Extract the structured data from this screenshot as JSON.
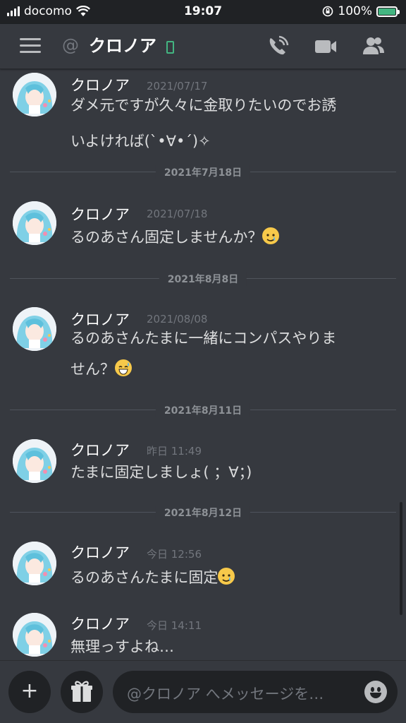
{
  "status_bar": {
    "carrier": "docomo",
    "time": "19:07",
    "battery": "100%",
    "battery_level": 1.0
  },
  "header": {
    "at_symbol": "@",
    "title": "クロノア"
  },
  "messages": [
    {
      "type": "message",
      "username": "クロノア",
      "timestamp": "2021/07/17",
      "lines": [
        "ダメ元ですが久々に金取りたいのでお誘",
        "いよければ(`•∀•´)✧"
      ],
      "emoji": null
    },
    {
      "type": "divider",
      "label": "2021年7月18日"
    },
    {
      "type": "message",
      "username": "クロノア",
      "timestamp": "2021/07/18",
      "lines": [
        "るのあさん固定しませんか？"
      ],
      "emoji": "sad-smiling-face"
    },
    {
      "type": "divider",
      "label": "2021年8月8日"
    },
    {
      "type": "message",
      "username": "クロノア",
      "timestamp": "2021/08/08",
      "lines": [
        "るのあさんたまに一緒にコンパスやりま",
        "せん？"
      ],
      "emoji": "grinning-face-with-sweat"
    },
    {
      "type": "divider",
      "label": "2021年8月11日"
    },
    {
      "type": "message",
      "username": "クロノア",
      "timestamp": "昨日 11:49",
      "lines": [
        "たまに固定しましょ( ；∀；)"
      ],
      "emoji": null
    },
    {
      "type": "divider",
      "label": "2021年8月12日"
    },
    {
      "type": "message",
      "username": "クロノア",
      "timestamp": "今日 12:56",
      "lines": [
        "るのあさんたまに固定"
      ],
      "emoji": "sad-smiling-face"
    },
    {
      "type": "message",
      "username": "クロノア",
      "timestamp": "今日 14:11",
      "lines": [
        "無理っすよね…"
      ],
      "emoji": null
    }
  ],
  "composer": {
    "placeholder": "@クロノア へメッセージを…",
    "add_icon": "+"
  },
  "colors": {
    "background": "#36393f",
    "status_bar": "#202225",
    "online": "#43b581",
    "battery_fill": "#43b581",
    "muted": "#72767d"
  },
  "icons": [
    "signal-icon",
    "wifi-icon",
    "lock-rotation-icon",
    "battery-icon",
    "hamburger-menu-icon",
    "mobile-status-icon",
    "voice-call-icon",
    "video-call-icon",
    "members-icon",
    "plus-icon",
    "gift-icon",
    "emoji-icon"
  ]
}
